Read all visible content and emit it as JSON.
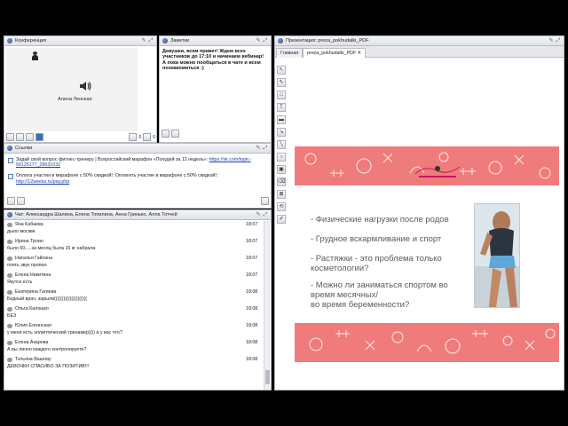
{
  "conference": {
    "title": "Конференция",
    "user_name": "Алена Ленская",
    "count_a": "0",
    "count_b": "0"
  },
  "notes": {
    "title": "Заметки",
    "text": "Девушки, всем привет! Ждем всех участников до 17:10 и начинаем вебинар! А пока можно пообщаться в чате и всем познакомиться :)"
  },
  "links": {
    "title": "Ссылки",
    "items": [
      {
        "text": "Задай свой вопрос фитнес-тренеру | Всероссийский марафон «Похудей за 12 недель»: ",
        "url": "https://vk.com/topic-56125177_28631032"
      },
      {
        "text": "Оплата участия в марафоне с 50% скидкой!: Оплатить участие в марафоне с 50% скидкой!: ",
        "url": "http://12weeks.ru/pay.php"
      }
    ]
  },
  "chat": {
    "title": "Чат: Александра Шалина, Елена Топилина, Анна Гринько, Алла Тотчей",
    "messages": [
      {
        "who": "Яна Кабаева",
        "time": "18:07",
        "text": "дыло москве"
      },
      {
        "who": "Ирина Троин",
        "time": "18:07",
        "text": "было 60.....за месяц была 15 кг набрала"
      },
      {
        "who": "Наталья Гайсина",
        "time": "18:07",
        "text": "опять звук пропал"
      },
      {
        "who": "Елена Никитина",
        "time": "18:07",
        "text": "Якутск есть"
      },
      {
        "who": "Екатерина Гагиева",
        "time": "18:08",
        "text": "Бедный врач, зарыли((((((((((((((((((((("
      },
      {
        "who": "Ольга Калошко",
        "time": "18:08",
        "text": "БЕЗ"
      },
      {
        "who": "Юлия Елгинская",
        "time": "18:08",
        "text": "у меня есть эллиптический тренажер)))) а у вас что?"
      },
      {
        "who": "Елена Азарова",
        "time": "18:08",
        "text": "А вы лично каждого контролируете?"
      },
      {
        "who": "Татьяна Вашлау",
        "time": "18:08",
        "text": "ДЕВОЧКИ СПАСИБО ЗА ПОЗИТИВ!!!"
      }
    ]
  },
  "presentation": {
    "title": "Презентация: preza_pokhudalki_PDF",
    "tab_main": "Главная",
    "tab_file": "preza_pokhudalki_PDF",
    "bullets": [
      "- Физические нагрузки после родов",
      "- Грудное вскармливание и спорт",
      "- Растяжки - это проблема только",
      "косметологии?",
      "- Можно ли заниматься спортом во",
      "время месячных/",
      "во время беременности?"
    ]
  },
  "colors": {
    "band": "#f07b7b",
    "link": "#1a3ea8"
  }
}
